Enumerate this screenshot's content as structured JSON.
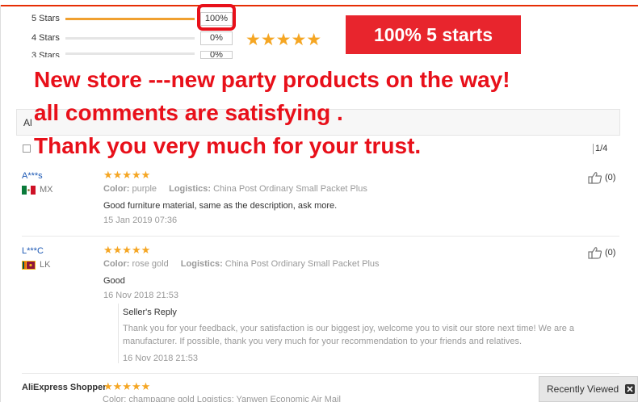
{
  "rating": {
    "rows": [
      {
        "label": "5 Stars",
        "percent_text": "100%",
        "fill_fraction": 1.0
      },
      {
        "label": "4 Stars",
        "percent_text": "0%",
        "fill_fraction": 0.0
      },
      {
        "label": "3 Stars",
        "percent_text": "0%",
        "fill_fraction": 0.0
      }
    ],
    "summary_stars": "★★★★★"
  },
  "promo": {
    "badge": "100% 5 starts",
    "lines": [
      "New store ---new party products on the way!",
      "all comments are satisfying .",
      "Thank you very much for your trust."
    ]
  },
  "filter": {
    "label_fragment": "Al",
    "page_text": "1/4"
  },
  "reviews": [
    {
      "buyer": "A***s",
      "country": "MX",
      "stars": "★★★★★",
      "color_label": "Color:",
      "color_value": "purple",
      "logistics_label": "Logistics:",
      "logistics_value": "China Post Ordinary Small Packet Plus",
      "text": "Good furniture material, same as the description, ask more.",
      "date": "15 Jan 2019 07:36",
      "helpful": "(0)"
    },
    {
      "buyer": "L***C",
      "country": "LK",
      "stars": "★★★★★",
      "color_label": "Color:",
      "color_value": "rose gold",
      "logistics_label": "Logistics:",
      "logistics_value": "China Post Ordinary Small Packet Plus",
      "text": "Good",
      "date": "16 Nov 2018 21:53",
      "helpful": "(0)",
      "seller_reply": {
        "title": "Seller's Reply",
        "text_line1": "Thank you for your feedback, your satisfaction is our biggest joy, welcome you to visit our store next time! We are a",
        "text_line2": "manufacturer. If possible, thank you very much for your recommendation to your friends and relatives.",
        "date": "16 Nov 2018 21:53"
      }
    },
    {
      "buyer": "AliExpress Shopper",
      "stars": "★★★★★",
      "partial_meta": "Color: champagne gold     Logistics: Yanwen Economic Air Mail"
    }
  ],
  "recently_viewed": {
    "label": "Recently Viewed"
  },
  "colors": {
    "accent_red": "#e8101a",
    "star_orange": "#f5a623",
    "link_blue": "#1c58b4"
  }
}
